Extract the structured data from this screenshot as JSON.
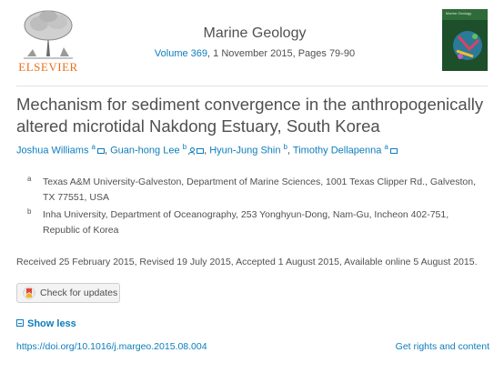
{
  "publisher": {
    "logo_text": "ELSEVIER"
  },
  "journal": {
    "title": "Marine Geology",
    "volume_link": "Volume 369",
    "issue_rest": ", 1 November 2015, Pages 79-90",
    "cover_text": "Marine Geology"
  },
  "article": {
    "title": "Mechanism for sediment convergence in the anthropogenically altered microtidal Nakdong Estuary, South Korea"
  },
  "authors": [
    {
      "name": "Joshua Williams",
      "affil": "a"
    },
    {
      "name": "Guan-hong Lee",
      "affil": "b"
    },
    {
      "name": "Hyun-Jung Shin",
      "affil": "b"
    },
    {
      "name": "Timothy Dellapenna",
      "affil": "a"
    }
  ],
  "affiliations": [
    {
      "key": "a",
      "text": "Texas A&M University-Galveston, Department of Marine Sciences, 1001 Texas Clipper Rd., Galveston, TX 77551, USA"
    },
    {
      "key": "b",
      "text": "Inha University, Department of Oceanography, 253 Yonghyun-Dong, Nam-Gu, Incheon 402-751, Republic of Korea"
    }
  ],
  "history": "Received 25 February 2015, Revised 19 July 2015, Accepted 1 August 2015, Available online 5 August 2015.",
  "buttons": {
    "check_updates": "Check for updates",
    "show_less": "Show less"
  },
  "links": {
    "doi": "https://doi.org/10.1016/j.margeo.2015.08.004",
    "rights": "Get rights and content"
  },
  "colors": {
    "link": "#0c7dbb",
    "brand_orange": "#e9711c",
    "text": "#505050"
  }
}
